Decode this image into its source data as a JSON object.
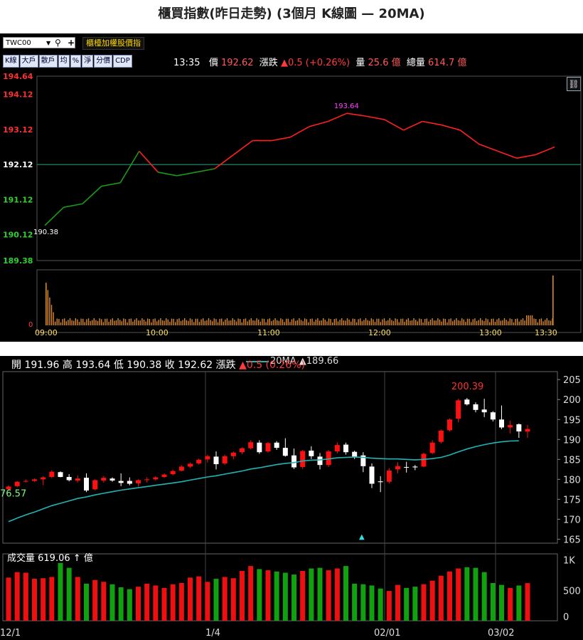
{
  "title": "櫃買指數(昨日走勢) (3個月 K線圖 — 20MA)",
  "intraday": {
    "symbol_value": "TWC00",
    "index_name": "櫃檯加權股價指",
    "buttons": [
      "K線",
      "大戶",
      "散戶",
      "均",
      "%",
      "淨",
      "分價",
      "CDP"
    ],
    "quote": {
      "time": "13:35",
      "price_label": "價",
      "price": "192.62",
      "change_label": "漲跌",
      "change": "▲0.5 (+0.26%)",
      "volume_label": "量",
      "volume": "25.6 億",
      "total_volume_label": "總量",
      "total_volume": "614.7 億"
    },
    "link_icon": "link-icon",
    "y_ticks": [
      "194.64",
      "194.12",
      "193.12",
      "192.12",
      "191.12",
      "190.12",
      "189.38"
    ],
    "high_label": "193.64",
    "low_label": "190.38",
    "volume_zero_label": "0",
    "x_ticks": [
      "09:00",
      "10:00",
      "11:00",
      "12:00",
      "13:00",
      "13:30"
    ],
    "colors": {
      "up": "#ff2020",
      "down": "#1a9a1a",
      "ref": "#2aa58a",
      "tick_red": "#ff3030",
      "tick_green": "#30d030",
      "high": "#ff40ff",
      "volume": "#d9882b"
    }
  },
  "kline": {
    "ohlc_header": {
      "open_label": "開",
      "open": "191.96",
      "high_label": "高",
      "high": "193.64",
      "low_label": "低",
      "low": "190.38",
      "close_label": "收",
      "close": "192.62",
      "change_label": "漲跌",
      "change": "▲0.5 (0.26%)"
    },
    "ma_legend": "20MA ▲189.66",
    "y_ticks": [
      "205",
      "200",
      "195",
      "190",
      "185",
      "180",
      "175",
      "170",
      "165"
    ],
    "high_marker": "200.39",
    "low_marker": "76.57",
    "volume_header": "成交量 619.06 ↑ 億",
    "volume_ticks": [
      "1K",
      "500",
      "0"
    ],
    "x_ticks": [
      "12/1",
      "1/4",
      "02/01",
      "03/02"
    ],
    "colors": {
      "up": "#ff1010",
      "down": "#ffffff",
      "ma": "#20b5b5",
      "vol_up": "#ee1010",
      "vol_down": "#10a010"
    }
  },
  "chart_data": [
    {
      "type": "line",
      "title": "",
      "xlabel": "",
      "ylabel": "",
      "ylim": [
        189.38,
        194.64
      ],
      "reference": 192.12,
      "x": [
        "09:00",
        "09:10",
        "09:20",
        "09:30",
        "09:40",
        "09:50",
        "10:00",
        "10:10",
        "10:20",
        "10:30",
        "10:40",
        "10:50",
        "11:00",
        "11:10",
        "11:20",
        "11:30",
        "11:40",
        "11:50",
        "12:00",
        "12:10",
        "12:20",
        "12:30",
        "12:40",
        "12:50",
        "13:00",
        "13:10",
        "13:20",
        "13:30"
      ],
      "series": [
        {
          "values": [
            190.38,
            190.9,
            191.0,
            191.5,
            191.6,
            192.5,
            191.9,
            191.8,
            191.9,
            192.0,
            192.4,
            192.8,
            192.8,
            192.9,
            193.2,
            193.35,
            193.58,
            193.5,
            193.4,
            193.1,
            193.35,
            193.25,
            193.1,
            192.7,
            192.5,
            192.3,
            192.4,
            192.62
          ]
        }
      ]
    },
    {
      "type": "candlestick",
      "title": "",
      "ylim": [
        164,
        207
      ],
      "categories": [
        "12/1",
        "12/2",
        "12/3",
        "12/4",
        "12/7",
        "12/8",
        "12/9",
        "12/10",
        "12/11",
        "12/14",
        "12/15",
        "12/16",
        "12/17",
        "12/18",
        "12/21",
        "12/22",
        "12/23",
        "12/24",
        "12/25",
        "12/28",
        "12/29",
        "12/30",
        "12/31",
        "1/4",
        "1/5",
        "1/6",
        "1/7",
        "1/8",
        "1/11",
        "1/12",
        "1/13",
        "1/14",
        "1/15",
        "1/18",
        "1/19",
        "1/20",
        "1/21",
        "1/22",
        "1/25",
        "1/26",
        "1/27",
        "1/28",
        "1/29",
        "02/01",
        "2/2",
        "2/3",
        "2/4",
        "2/5",
        "2/17",
        "2/18",
        "2/19",
        "2/22",
        "2/23",
        "2/24",
        "2/25",
        "2/26",
        "03/02",
        "3/3",
        "3/4"
      ],
      "ohlc": [
        [
          177.5,
          178.5,
          177.3,
          178.2
        ],
        [
          178.3,
          179.6,
          178.0,
          179.4
        ],
        [
          179.5,
          180.0,
          179.2,
          179.6
        ],
        [
          179.6,
          180.2,
          179.4,
          180.0
        ],
        [
          180.0,
          180.8,
          178.6,
          180.5
        ],
        [
          180.6,
          182.3,
          180.3,
          181.9
        ],
        [
          181.8,
          182.0,
          180.5,
          180.6
        ],
        [
          180.6,
          181.3,
          179.5,
          179.8
        ],
        [
          179.7,
          181.0,
          179.2,
          180.2
        ],
        [
          180.4,
          181.5,
          176.8,
          177.2
        ],
        [
          177.5,
          180.0,
          177.2,
          179.8
        ],
        [
          179.7,
          180.8,
          179.2,
          180.4
        ],
        [
          180.2,
          180.5,
          179.4,
          179.7
        ],
        [
          179.6,
          181.5,
          178.3,
          179.1
        ],
        [
          179.6,
          180.5,
          178.5,
          178.9
        ],
        [
          179.0,
          180.0,
          178.2,
          179.8
        ],
        [
          179.8,
          180.5,
          179.2,
          180.0
        ],
        [
          180.0,
          180.8,
          179.7,
          180.5
        ],
        [
          180.6,
          181.5,
          180.4,
          181.2
        ],
        [
          181.3,
          182.4,
          181.0,
          182.1
        ],
        [
          182.2,
          183.5,
          182.0,
          183.2
        ],
        [
          183.2,
          184.2,
          182.9,
          183.9
        ],
        [
          184.0,
          185.2,
          183.7,
          184.9
        ],
        [
          185.0,
          186.2,
          184.2,
          185.8
        ],
        [
          185.7,
          187.0,
          182.5,
          183.8
        ],
        [
          184.0,
          186.2,
          183.6,
          185.8
        ],
        [
          185.8,
          187.0,
          185.0,
          186.7
        ],
        [
          186.8,
          188.0,
          186.3,
          187.8
        ],
        [
          187.8,
          189.8,
          187.5,
          189.3
        ],
        [
          189.2,
          189.8,
          186.4,
          186.8
        ],
        [
          187.0,
          189.4,
          186.7,
          189.1
        ],
        [
          189.2,
          189.6,
          187.4,
          187.9
        ],
        [
          187.9,
          190.3,
          185.7,
          185.9
        ],
        [
          186.0,
          187.7,
          182.6,
          183.0
        ],
        [
          183.1,
          187.4,
          182.6,
          187.1
        ],
        [
          187.2,
          188.3,
          185.1,
          185.8
        ],
        [
          185.7,
          186.6,
          182.5,
          183.6
        ],
        [
          183.6,
          187.4,
          183.1,
          187.0
        ],
        [
          187.0,
          189.3,
          186.5,
          188.6
        ],
        [
          188.7,
          189.2,
          186.2,
          186.8
        ],
        [
          186.9,
          187.2,
          185.1,
          185.7
        ],
        [
          186.0,
          186.8,
          181.8,
          183.3
        ],
        [
          183.2,
          184.0,
          177.8,
          178.9
        ],
        [
          179.5,
          180.8,
          176.8,
          179.3
        ],
        [
          179.4,
          182.8,
          179.0,
          182.2
        ],
        [
          182.5,
          184.3,
          181.5,
          183.3
        ],
        [
          183.1,
          184.4,
          181.7,
          183.0
        ],
        [
          183.2,
          183.6,
          182.3,
          183.0
        ],
        [
          183.2,
          186.7,
          183.0,
          186.4
        ],
        [
          186.6,
          189.8,
          186.3,
          189.2
        ],
        [
          189.4,
          192.5,
          189.0,
          192.2
        ],
        [
          192.3,
          195.3,
          192.0,
          195.0
        ],
        [
          195.2,
          200.2,
          194.3,
          199.8
        ],
        [
          200.0,
          200.39,
          198.5,
          198.8
        ],
        [
          198.8,
          199.3,
          196.8,
          197.4
        ],
        [
          197.5,
          200.2,
          195.6,
          196.8
        ],
        [
          196.8,
          197.1,
          194.5,
          195.0
        ],
        [
          195.0,
          198.5,
          192.6,
          193.0
        ],
        [
          193.0,
          194.7,
          191.5,
          193.6
        ],
        [
          193.8,
          194.0,
          190.4,
          192.0
        ],
        [
          191.96,
          193.64,
          190.38,
          192.62
        ]
      ],
      "ma20": [
        169.4,
        170.3,
        171.1,
        171.8,
        172.6,
        173.4,
        174.0,
        174.6,
        175.2,
        175.6,
        176.1,
        176.5,
        176.9,
        177.3,
        177.6,
        177.9,
        178.2,
        178.5,
        178.8,
        179.1,
        179.4,
        179.8,
        180.2,
        180.6,
        180.9,
        181.3,
        181.7,
        182.1,
        182.6,
        182.9,
        183.3,
        183.7,
        184.0,
        184.2,
        184.6,
        184.8,
        184.9,
        185.1,
        185.4,
        185.5,
        185.6,
        185.5,
        185.3,
        185.2,
        185.1,
        185.1,
        185.0,
        184.9,
        185.0,
        185.2,
        185.5,
        186.1,
        186.9,
        187.6,
        188.2,
        188.7,
        189.1,
        189.4,
        189.6,
        189.66
      ],
      "volume": [
        710,
        800,
        790,
        690,
        700,
        720,
        950,
        870,
        720,
        610,
        670,
        640,
        600,
        550,
        520,
        560,
        610,
        580,
        540,
        600,
        620,
        710,
        730,
        640,
        690,
        720,
        700,
        820,
        900,
        850,
        830,
        810,
        790,
        760,
        820,
        860,
        870,
        830,
        860,
        900,
        610,
        600,
        580,
        530,
        490,
        590,
        540,
        560,
        600,
        660,
        740,
        810,
        860,
        880,
        870,
        800,
        620,
        590,
        540,
        580,
        619
      ]
    }
  ]
}
